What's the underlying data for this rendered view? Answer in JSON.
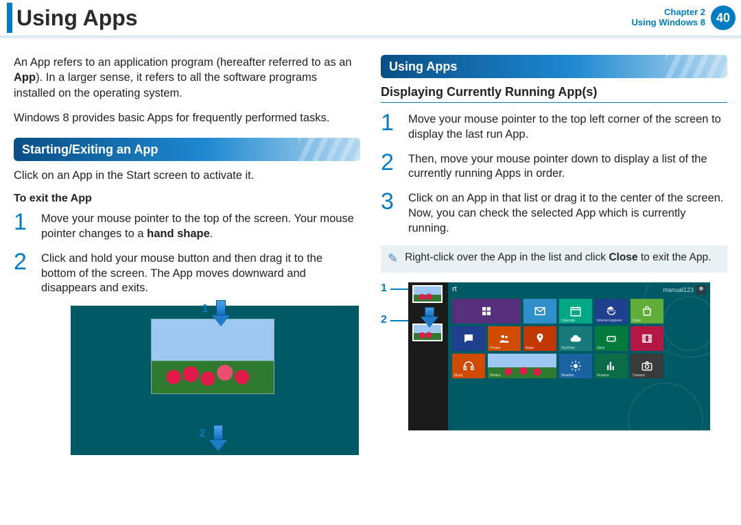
{
  "header": {
    "title": "Using Apps",
    "chapter_line1": "Chapter 2",
    "chapter_line2": "Using Windows 8",
    "page_number": "40"
  },
  "left": {
    "intro_p1_a": "An App refers to an application program (hereafter referred to as an ",
    "intro_p1_b_bold": "App",
    "intro_p1_c": "). In a larger sense, it refers to all the software programs installed on the operating system.",
    "intro_p2": "Windows 8 provides basic Apps for frequently performed tasks.",
    "section1_title": "Starting/Exiting an App",
    "section1_p": "Click on an App in the Start screen to activate it.",
    "exit_title": "To exit the App",
    "steps": [
      {
        "n": "1",
        "a": "Move your mouse pointer to the top of the screen. Your mouse pointer changes to a ",
        "b_bold": "hand shape",
        "c": "."
      },
      {
        "n": "2",
        "a": "Click and hold your mouse button and then drag it to the bottom of the screen. The App moves downward and disappears and exits."
      }
    ],
    "callouts": {
      "c1": "1",
      "c2": "2"
    }
  },
  "right": {
    "section_title": "Using Apps",
    "sub_title": "Displaying Currently Running App(s)",
    "steps": [
      {
        "n": "1",
        "t": "Move your mouse pointer to the top left corner of the screen to display the last run App."
      },
      {
        "n": "2",
        "t": "Then, move your mouse pointer down to display a list of the currently running Apps in order."
      },
      {
        "n": "3",
        "t": "Click on an App in that list or drag it to the center of the screen. Now, you can check the selected App which is currently running."
      }
    ],
    "note_a": "Right-click over the App in the list and click  ",
    "note_bold": "Close",
    "note_b": "  to exit the App.",
    "callouts": {
      "c1": "1",
      "c2": "2"
    },
    "start_label": "rt",
    "user_label": "manual123",
    "tiles": [
      {
        "color": "#56307a",
        "cap": ""
      },
      {
        "color": "#2f90c9",
        "cap": ""
      },
      {
        "color": "#00a884",
        "cap": "Calendar"
      },
      {
        "color": "#1f3f8f",
        "cap": "Internet Explorer"
      },
      {
        "color": "#5fae39",
        "cap": "Store"
      },
      {
        "color": "#1f3f8f",
        "cap": ""
      },
      {
        "color": "#d04a00",
        "cap": "People"
      },
      {
        "color": "#c23600",
        "cap": "Maps"
      },
      {
        "color": "#16797a",
        "cap": "SkyDrive"
      },
      {
        "color": "#047a3d",
        "cap": "Xbox"
      },
      {
        "color": "#b51745",
        "cap": ""
      },
      {
        "color": "#d04a00",
        "cap": "Music"
      },
      {
        "color": "",
        "cap": "Photos"
      },
      {
        "color": "#1b63a0",
        "cap": "Weather"
      },
      {
        "color": "#0a6d47",
        "cap": "Finance"
      },
      {
        "color": "#3a3a3a",
        "cap": "Camera"
      }
    ]
  }
}
